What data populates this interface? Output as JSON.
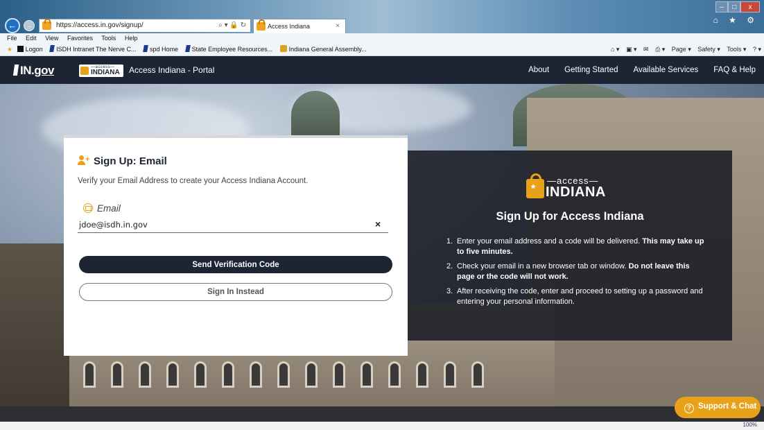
{
  "browser": {
    "url": "https://access.in.gov/signup/",
    "address_controls": "⌕ ▾ 🔒 ↻",
    "tab_title": "Access Indiana",
    "tab_close": "×",
    "window_controls": {
      "minimize": "–",
      "maximize": "□",
      "close": "x"
    },
    "toolbar_icons": "⌂ ★ ⚙",
    "menu": [
      "File",
      "Edit",
      "View",
      "Favorites",
      "Tools",
      "Help"
    ],
    "favorites": [
      {
        "label": "Logon",
        "icon": "black-square-icon"
      },
      {
        "label": "ISDH Intranet The Nerve C...",
        "icon": "state-favicon"
      },
      {
        "label": "spd Home",
        "icon": "state-favicon"
      },
      {
        "label": "State Employee Resources...",
        "icon": "state-favicon"
      },
      {
        "label": "Indiana General Assembly...",
        "icon": "seal-favicon"
      }
    ],
    "command_bar": [
      "⌂ ▾",
      "▣ ▾",
      "✉",
      "⎙ ▾",
      "Page ▾",
      "Safety ▾",
      "Tools ▾",
      "? ▾"
    ],
    "zoom": "100%"
  },
  "site": {
    "logo": {
      "prefix": "IN.",
      "suffix": "gov"
    },
    "badge": {
      "top": "—access—",
      "bottom": "INDIANA"
    },
    "portal_title": "Access Indiana - Portal",
    "nav": [
      "About",
      "Getting Started",
      "Available Services",
      "FAQ & Help"
    ]
  },
  "signup": {
    "title": "Sign Up: Email",
    "subtitle": "Verify your Email Address to create your Access Indiana Account.",
    "email_label": "Email",
    "email_value": "jdoe@isdh.in.gov",
    "clear": "×",
    "send_label": "Send Verification Code",
    "signin_label": "Sign In Instead"
  },
  "info": {
    "logo_top": "—access—",
    "logo_bottom": "INDIANA",
    "title": "Sign Up for Access Indiana",
    "steps": [
      {
        "num": "1.",
        "text": "Enter your email address and a code will be delivered. ",
        "bold": "This may take up to five minutes."
      },
      {
        "num": "2.",
        "text": "Check your email in a new browser tab or window. ",
        "bold": "Do not leave this page or the code will not work."
      },
      {
        "num": "3.",
        "text": "After receiving the code, enter and proceed to setting up a password and entering your personal information.",
        "bold": ""
      }
    ]
  },
  "support": {
    "label": "Support & Chat",
    "icon": "?"
  },
  "colors": {
    "navy": "#1d2434",
    "accent": "#e8a21a"
  }
}
